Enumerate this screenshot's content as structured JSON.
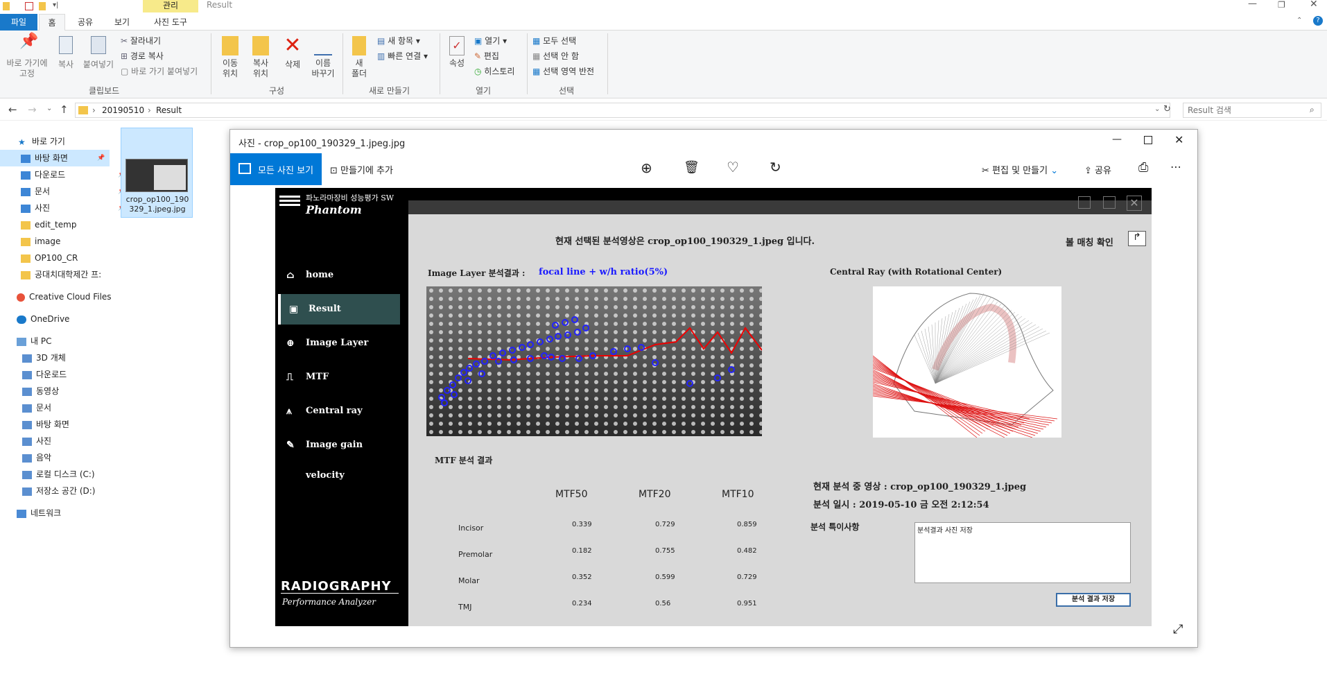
{
  "explorer": {
    "window_title": "Result",
    "tabs": [
      "파일",
      "홈",
      "공유",
      "보기",
      "사진 도구"
    ],
    "context_tab_group": "관리",
    "clipboard": {
      "group_label": "클립보드",
      "pin_label": "바로 가기에 고정",
      "copy_label": "복사",
      "paste_label": "붙여넣기",
      "cut_label": "잘라내기",
      "copy_path_label": "경로 복사",
      "paste_shortcut_label": "바로 가기 붙여넣기"
    },
    "organize": {
      "group_label": "구성",
      "move_label": "이동 위치",
      "copy_to_label": "복사 위치",
      "delete_label": "삭제",
      "rename_label": "이름 바꾸기"
    },
    "new": {
      "group_label": "새로 만들기",
      "new_folder_label": "새 폴더",
      "new_item_label": "새 항목",
      "easy_access_label": "빠른 연결"
    },
    "open": {
      "group_label": "열기",
      "properties_label": "속성",
      "open_label": "열기",
      "edit_label": "편집",
      "history_label": "히스토리"
    },
    "select": {
      "group_label": "선택",
      "select_all_label": "모두 선택",
      "select_none_label": "선택 안 함",
      "invert_label": "선택 영역 반전"
    },
    "breadcrumb": [
      "20190510",
      "Result"
    ],
    "search_placeholder": "Result 검색",
    "nav": {
      "quick_access": "바로 가기",
      "quick_items": [
        "바탕 화면",
        "다운로드",
        "문서",
        "사진",
        "edit_temp",
        "image",
        "OP100_CR",
        "공대치대학제간 프:"
      ],
      "creative_cloud": "Creative Cloud Files",
      "onedrive": "OneDrive",
      "this_pc": "내 PC",
      "pc_items": [
        "3D 개체",
        "다운로드",
        "동영상",
        "문서",
        "바탕 화면",
        "사진",
        "음악",
        "로컬 디스크 (C:)",
        "저장소 공간 (D:)"
      ],
      "network": "네트워크"
    },
    "file": {
      "name_line1": "crop_op100_190",
      "name_line2": "329_1.jpeg.jpg"
    }
  },
  "photos": {
    "title": "사진 - crop_op100_190329_1.jpeg.jpg",
    "all_photos_label": "모든 사진 보기",
    "add_to_creation_label": "만들기에 추가",
    "edit_create_label": "편집 및 만들기",
    "share_label": "공유"
  },
  "app": {
    "brand_small": "파노라마장비 성능평가 SW",
    "brand_big": "Phantom",
    "footer_line1": "RADIOGRAPHY",
    "footer_line2": "Performance Analyzer",
    "menu": [
      "home",
      "Result",
      "Image Layer",
      "MTF",
      "Central ray",
      "Image gain velocity"
    ],
    "selected_menu": "Result",
    "current_image_msg": "현재 선택된 분석영상은 crop_op100_190329_1.jpeg 입니다.",
    "ball_matching_label": "볼 매칭 확인",
    "image_layer_label": "Image Layer 분석결과 :",
    "image_layer_value": "focal line + w/h ratio(5%)",
    "central_ray_label": "Central Ray (with Rotational Center)",
    "mtf_result_label": "MTF 분석 결과",
    "mtf_headers": [
      "MTF50",
      "MTF20",
      "MTF10"
    ],
    "mtf_rows": [
      {
        "name": "Incisor",
        "v": [
          "0.339",
          "0.729",
          "0.859"
        ]
      },
      {
        "name": "Premolar",
        "v": [
          "0.182",
          "0.755",
          "0.482"
        ]
      },
      {
        "name": "Molar",
        "v": [
          "0.352",
          "0.599",
          "0.729"
        ]
      },
      {
        "name": "TMJ",
        "v": [
          "0.234",
          "0.56",
          "0.951"
        ]
      }
    ],
    "current_analysis": "현재 분석 중 영상 : crop_op100_190329_1.jpeg",
    "analysis_date": "분석 일시 : 2019-05-10 금 오전 2:12:54",
    "notes_label": "분석 특이사항",
    "notes_value": "분석결과 사진 저장",
    "save_button_label": "분석 결과 저장"
  },
  "colors": {
    "accent": "#0078d7",
    "selected_menu": "#2f4f4f",
    "focal_text": "#1a1aff"
  }
}
